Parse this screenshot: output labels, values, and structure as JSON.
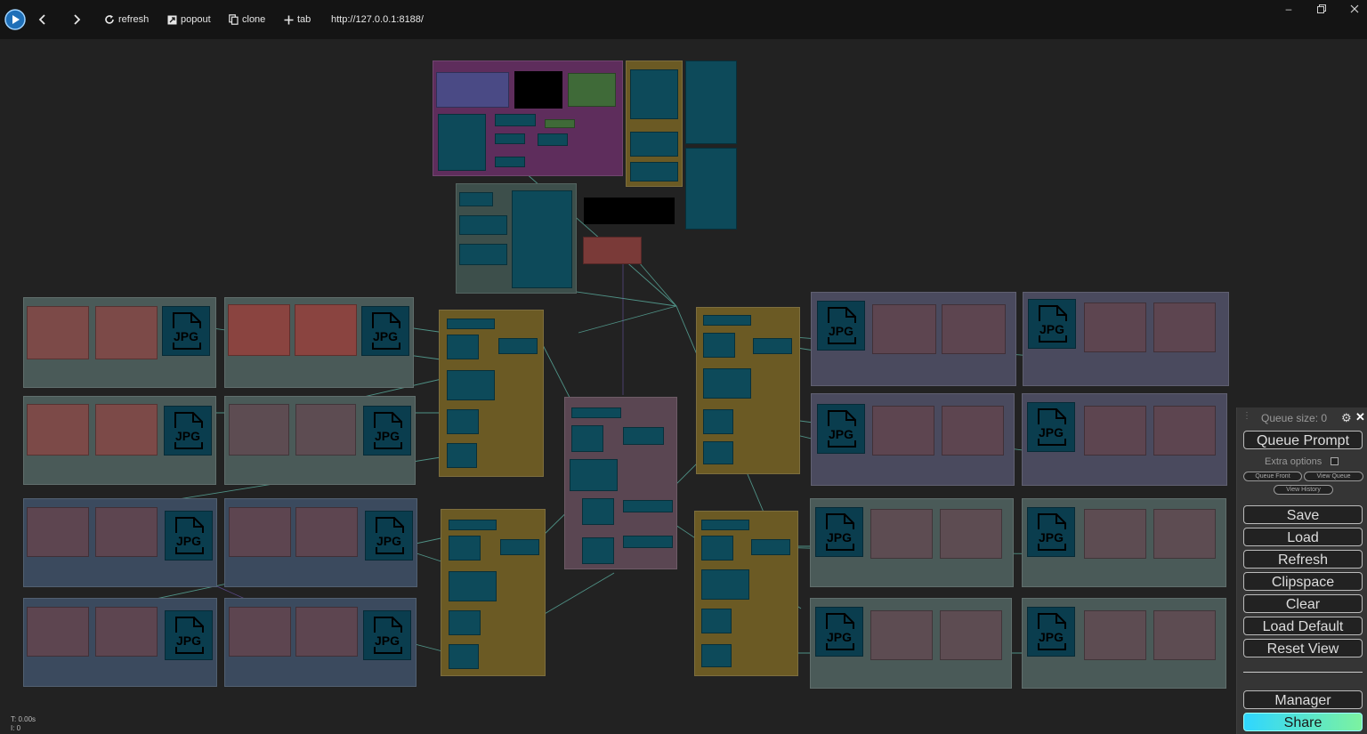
{
  "toolbar": {
    "refresh_label": "refresh",
    "popout_label": "popout",
    "clone_label": "clone",
    "tab_label": "tab",
    "url": "http://127.0.0.1:8188/"
  },
  "canvas": {
    "jpg_label": "JPG"
  },
  "stats": {
    "time": "T: 0.00s",
    "index": "I: 0"
  },
  "menu": {
    "queue_size": "Queue size: 0",
    "queue_prompt": "Queue Prompt",
    "extra_options": "Extra options",
    "queue_front": "Queue Front",
    "view_queue": "View Queue",
    "view_history": "View History",
    "save": "Save",
    "load": "Load",
    "refresh": "Refresh",
    "clipspace": "Clipspace",
    "clear": "Clear",
    "load_default": "Load Default",
    "reset_view": "Reset View",
    "manager": "Manager",
    "share": "Share"
  },
  "colors": {
    "share_gradient_start": "#2fd6ff",
    "share_gradient_end": "#7cf2a0",
    "node_teal": "#0d4a5a",
    "group_purple": "#6b2e6b",
    "group_gold": "#6b5a24"
  }
}
